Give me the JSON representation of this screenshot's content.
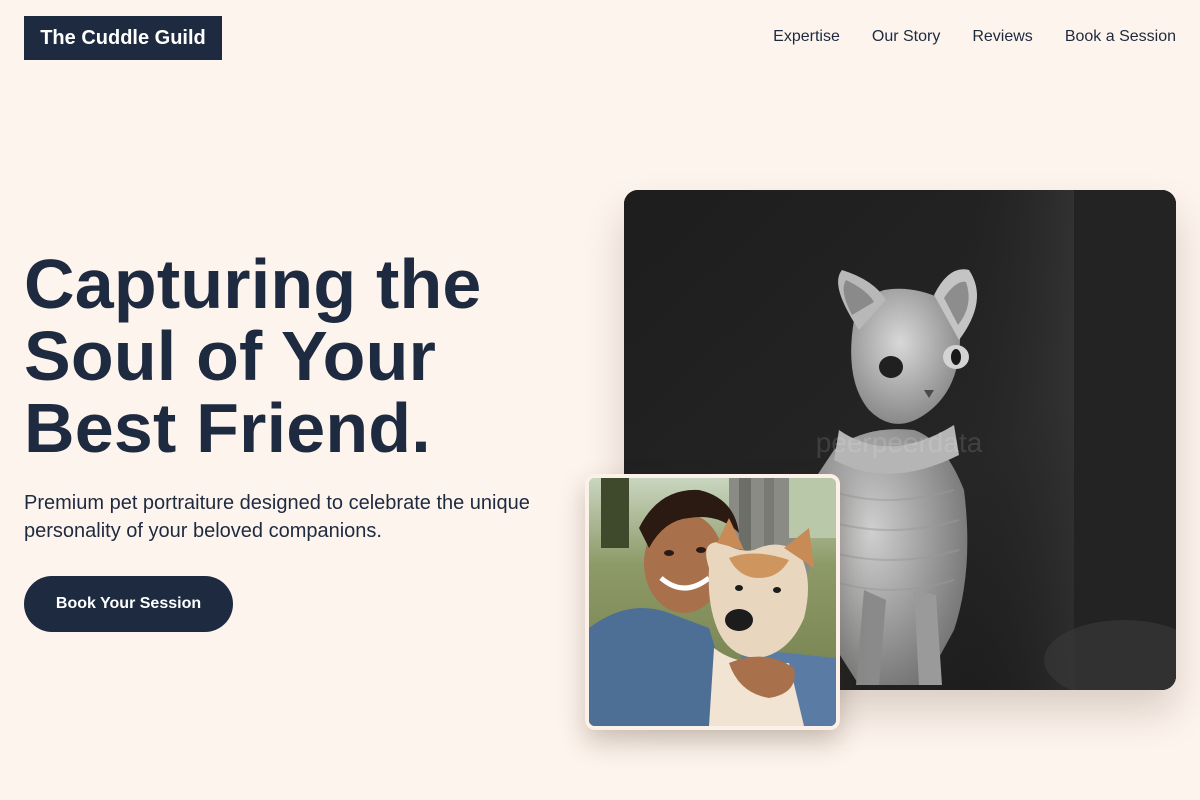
{
  "brand": {
    "name": "The Cuddle Guild"
  },
  "nav": {
    "items": [
      {
        "label": "Expertise"
      },
      {
        "label": "Our Story"
      },
      {
        "label": "Reviews"
      },
      {
        "label": "Book a Session"
      }
    ]
  },
  "hero": {
    "headline": "Capturing the Soul of Your Best Friend.",
    "subtitle": "Premium pet portraiture designed to celebrate the unique personality of your beloved companions.",
    "cta_label": "Book Your Session"
  },
  "images": {
    "main": {
      "icon": "sphynx-cat-photo"
    },
    "inset": {
      "icon": "woman-with-shiba-dog-photo"
    }
  },
  "colors": {
    "background": "#fdf4ed",
    "navy": "#1e2a3f",
    "white": "#ffffff"
  }
}
